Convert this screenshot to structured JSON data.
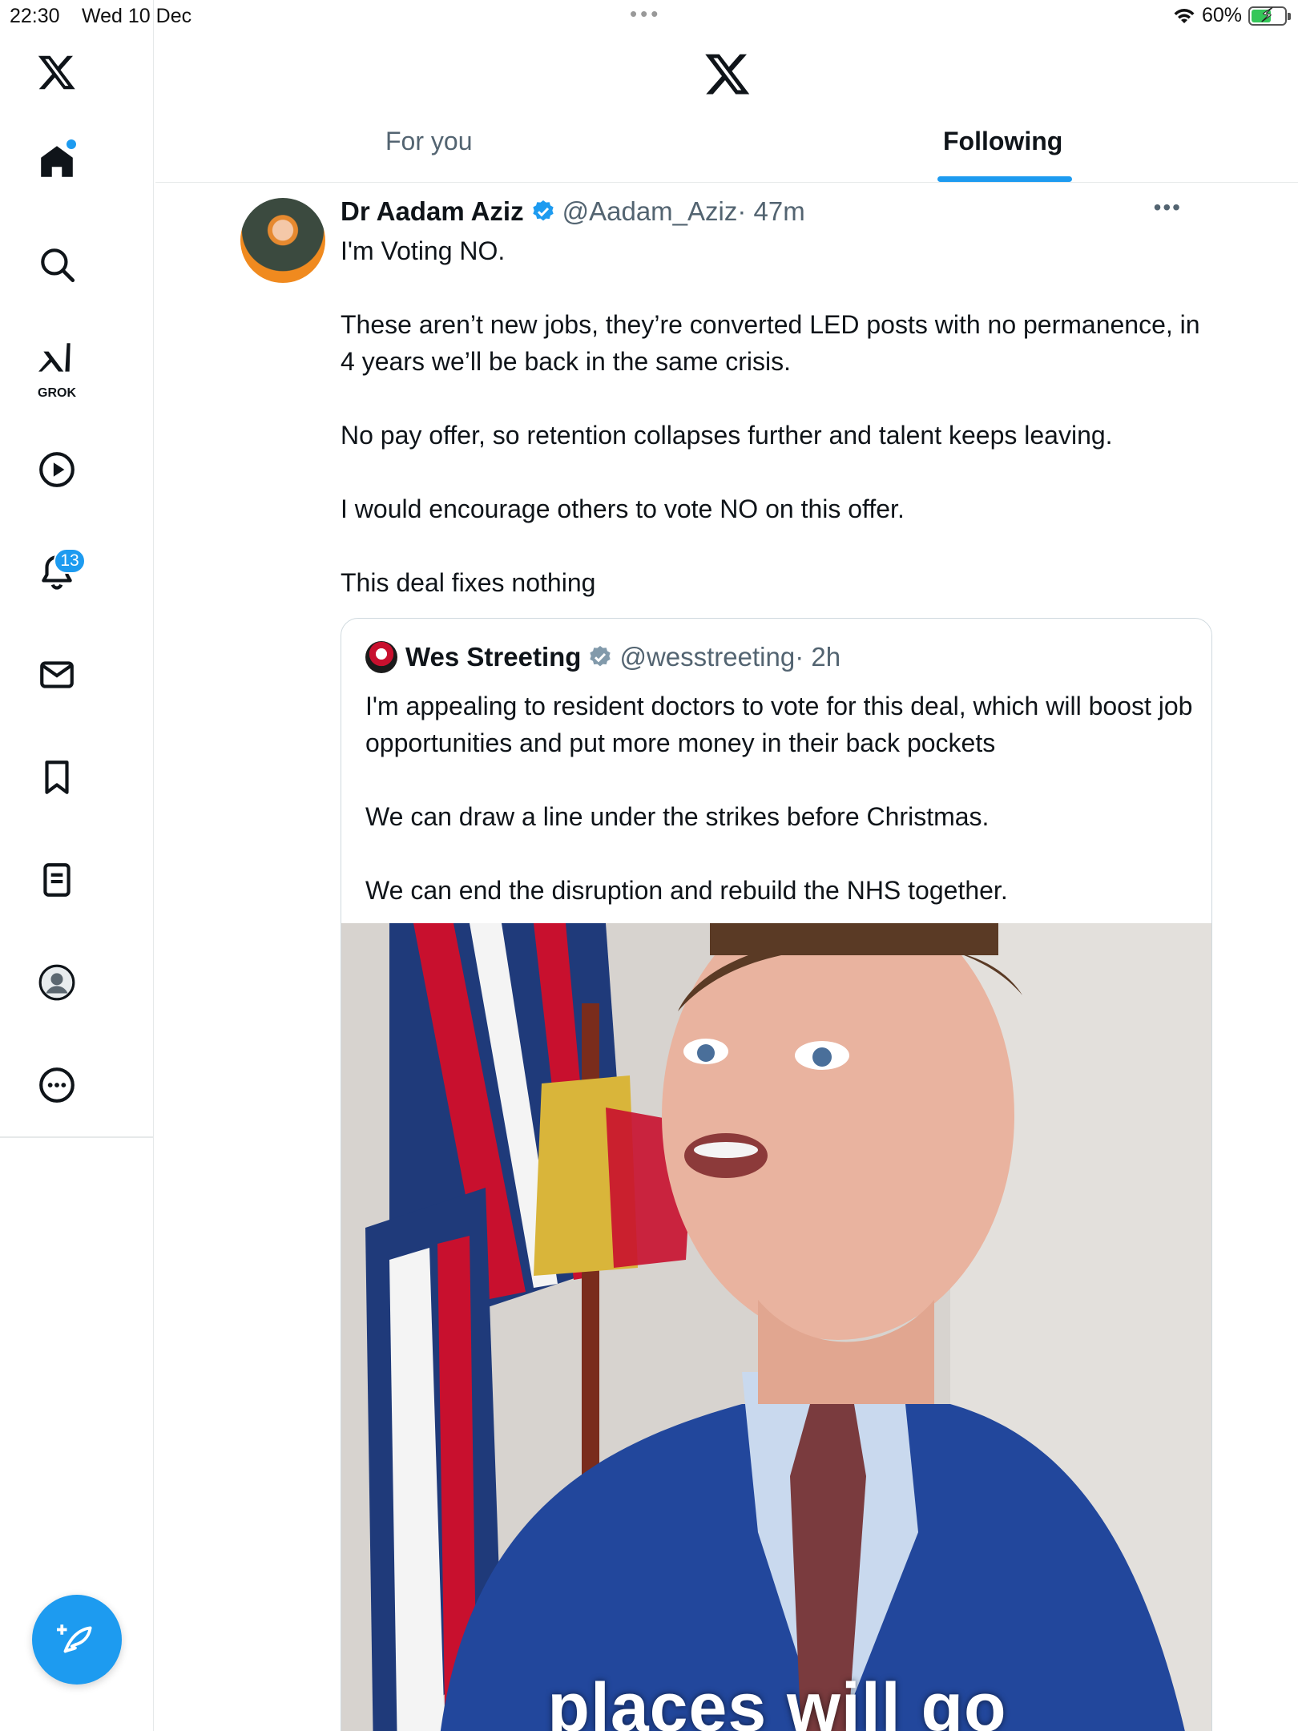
{
  "status_bar": {
    "time": "22:30",
    "date": "Wed 10 Dec",
    "battery": "60%",
    "battery_level": 0.6
  },
  "sidebar": {
    "notification_count": "13",
    "grok_label": "GROK",
    "items": [
      {
        "icon": "x-logo-icon"
      },
      {
        "icon": "home-icon"
      },
      {
        "icon": "search-icon"
      },
      {
        "icon": "grok-icon"
      },
      {
        "icon": "video-icon"
      },
      {
        "icon": "bell-icon"
      },
      {
        "icon": "mail-icon"
      },
      {
        "icon": "bookmark-icon"
      },
      {
        "icon": "lists-icon"
      },
      {
        "icon": "profile-icon"
      },
      {
        "icon": "more-icon"
      }
    ]
  },
  "header": {
    "tabs": [
      "For you",
      "Following"
    ],
    "active_tab": "Following"
  },
  "tweet": {
    "name": "Dr Aadam Aziz",
    "handle": "@Aadam_Aziz",
    "time": "· 47m",
    "text": [
      "I'm Voting NO.",
      "These aren’t new jobs, they’re converted LED posts with no permanence, in 4 years we’ll be back in the same crisis.",
      "No pay offer, so retention collapses further and talent keeps leaving.",
      "I would encourage others to vote NO on this offer.",
      "This deal fixes nothing"
    ]
  },
  "quoted_tweet": {
    "name": "Wes Streeting",
    "handle": "@wesstreeting",
    "time": "· 2h",
    "text": [
      "I'm appealing to resident doctors to vote for this deal, which will boost job opportunities and put more money in their back pockets",
      "We can draw a line under the strikes before Christmas.",
      "We can end the disruption and rebuild the NHS together."
    ],
    "media_caption": "places will go"
  },
  "colors": {
    "accent": "#1d9bf0",
    "text": "#0f1419",
    "secondary": "#536471",
    "border": "#e6e9ea"
  }
}
